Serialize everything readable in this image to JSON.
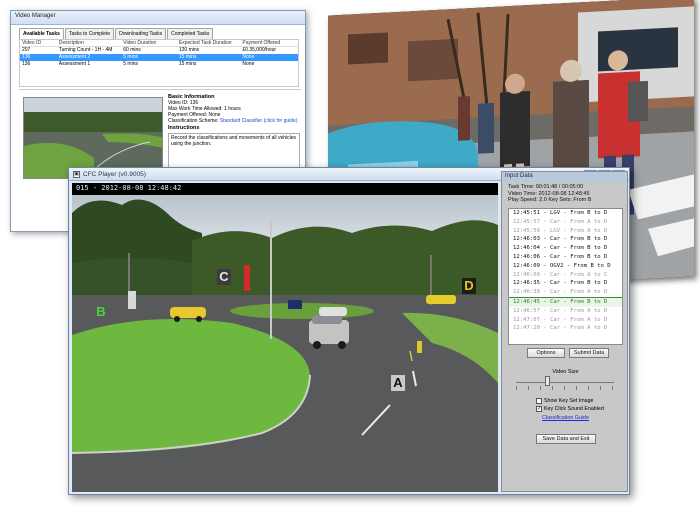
{
  "video_manager": {
    "title": "Video Manager",
    "tabs": [
      "Available Tasks",
      "Tasks to Complete",
      "Downloading Tasks",
      "Completed Tasks"
    ],
    "columns": [
      "Video ID",
      "Description",
      "Video Duration",
      "Expected Task Duration",
      "Payment Offered"
    ],
    "rows": [
      [
        "207",
        "Turning Count - 1H - 4M",
        "60 mins",
        "120 mins",
        "£0.35,000/hour"
      ],
      [
        "136",
        "Assessment 2",
        "5 mins",
        "15 mins",
        "None"
      ],
      [
        "136",
        "Assessment 1",
        "5 mins",
        "15 mins",
        "None"
      ]
    ],
    "info": {
      "heading": "Basic Information",
      "lines": [
        "Video ID: 136",
        "Max Work Time Allowed: 1 hours",
        "Payment Offered: None"
      ],
      "scheme_prefix": "Classification Scheme:",
      "scheme_link": "Standard Classifier (click for guide)",
      "instructions_heading": "Instructions",
      "instructions": "Record the classifications and movements of all vehicles using the junction."
    }
  },
  "player": {
    "title": "CFC Player (v0.9005)",
    "overlay": "015 - 2012-08-08 12:48:42",
    "markers": [
      "A",
      "B",
      "C",
      "D"
    ]
  },
  "input_panel": {
    "title": "Input Data",
    "task_time": "Task Time:  00:01:48 / 00:05:00",
    "video_time": "Video Time:  2012-08-08 12:48:45",
    "play_speed": "Play Speed:  2.0   Key Sets: From B",
    "entries": [
      {
        "text": "12:45:51 - LGV - From B to D",
        "state": "normal"
      },
      {
        "text": "12:45:57 - Car - From A to D",
        "state": "dim"
      },
      {
        "text": "12:45:59 - LGV - From A to D",
        "state": "dim"
      },
      {
        "text": "12:46:03 - Car - From B to D",
        "state": "normal"
      },
      {
        "text": "12:46:04 - Car - From B to D",
        "state": "normal"
      },
      {
        "text": "12:46:06 - Car - From B to D",
        "state": "normal"
      },
      {
        "text": "12:46:09 - OGV2 - From B to D",
        "state": "normal"
      },
      {
        "text": "12:46:09 - Car - From A to C",
        "state": "dim"
      },
      {
        "text": "12:46:35 - Car - From B to D",
        "state": "normal"
      },
      {
        "text": "12:46:38 - Car - From A to D",
        "state": "dim"
      },
      {
        "text": "12:46:45 - Car - From B to D",
        "state": "selected"
      },
      {
        "text": "12:46:57 - Car - From A to D",
        "state": "dim"
      },
      {
        "text": "12:47:07 - Car - From A to D",
        "state": "dim"
      },
      {
        "text": "12:47:20 - Car - From A to D",
        "state": "dim"
      }
    ],
    "options_label": "Options",
    "submit_label": "Submit Data",
    "video_size_label": "Video Size",
    "video_size_level": 0.33,
    "show_key_set_label": "Show Key Set Image",
    "key_click_label": "Key Click Sound Enabled",
    "guide_link": "Classification Guide",
    "save_exit_label": "Save Data and Exit"
  }
}
